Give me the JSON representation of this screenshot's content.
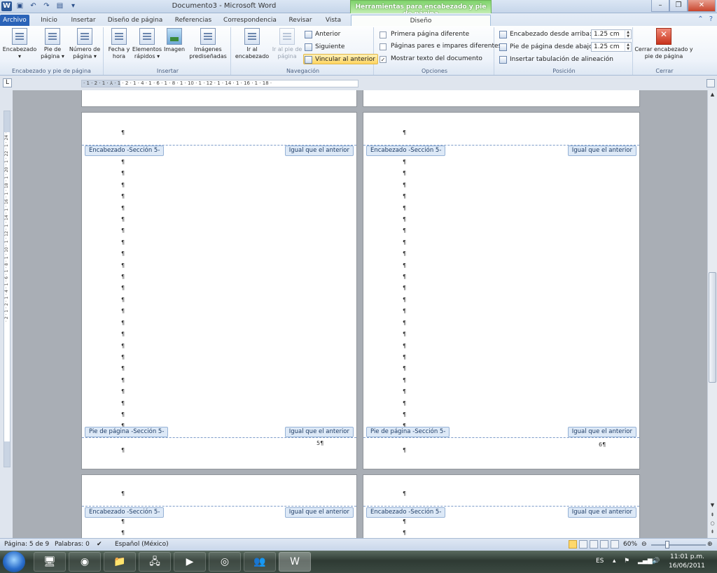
{
  "window": {
    "doc_title": "Documento3 - Microsoft Word",
    "contextual_header": "Herramientas para encabezado y pie de página"
  },
  "tabs": [
    "Archivo",
    "Inicio",
    "Insertar",
    "Diseño de página",
    "Referencias",
    "Correspondencia",
    "Revisar",
    "Vista",
    "Diseño"
  ],
  "ribbon": {
    "groups": {
      "header_footer": "Encabezado y pie de página",
      "insert": "Insertar",
      "navigation": "Navegación",
      "options": "Opciones",
      "position": "Posición",
      "close": "Cerrar"
    },
    "buttons": {
      "encabezado": "Encabezado",
      "pie_pagina": "Pie de página",
      "numero_pagina": "Número de página",
      "fecha_hora": "Fecha y hora",
      "elementos_rapidos": "Elementos rápidos",
      "imagen": "Imagen",
      "imagenes_prediseñadas": "Imágenes prediseñadas",
      "ir_encabezado": "Ir al encabezado",
      "ir_pie": "Ir al pie de página",
      "anterior": "Anterior",
      "siguiente": "Siguiente",
      "vincular": "Vincular al anterior",
      "cerrar": "Cerrar encabezado y pie de página"
    },
    "options": {
      "primera_pagina": "Primera página diferente",
      "pares_impares": "Páginas pares e impares diferentes",
      "mostrar_texto": "Mostrar texto del documento"
    },
    "position": {
      "encabezado_label": "Encabezado desde arriba:",
      "encabezado_value": "1.25 cm",
      "pie_label": "Pie de página desde abajo:",
      "pie_value": "1.25 cm",
      "tabulacion": "Insertar tabulación de alineación"
    }
  },
  "ruler": {
    "h_ticks": "· 1 · 2 · 1 · ⅄ · 1 · 2 · 1 · 4 · 1 · 6 · 1 · 8 · 1 · 10 · 1 · 12 · 1 · 14 · 1 · 16 · 1 · 18 ·",
    "v_ticks": "· 2 · 1 · 2 · 1 · 4 · 1 · 6 · 1 · 8 · 1 · 10 · 1 · 12 · 1 · 14 · 1 · 16 · 1 · 18 · 1 · 20 · 1 · 22 · 1 · 24 ·"
  },
  "document": {
    "pilcrow": "¶",
    "header_tag": "Encabezado -Sección 5-",
    "footer_tag": "Pie de página -Sección 5-",
    "same_as_previous": "Igual que el anterior",
    "page5_num": "5¶",
    "page6_num": "6¶"
  },
  "status": {
    "page": "Página: 5 de 9",
    "words": "Palabras: 0",
    "language": "Español (México)",
    "zoom": "60%"
  },
  "taskbar": {
    "lang": "ES",
    "time": "11:01 p.m.",
    "date": "16/06/2011"
  }
}
